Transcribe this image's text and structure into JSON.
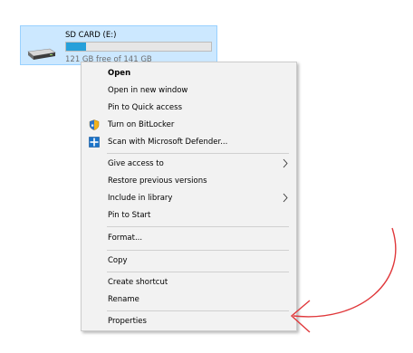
{
  "drive": {
    "name": "SD CARD (E:)",
    "free_text": "121 GB free of 141 GB",
    "used_fraction": 0.14,
    "icon": "sd-card-drive-icon"
  },
  "context_menu": {
    "items": [
      {
        "label": "Open",
        "bold": true
      },
      {
        "label": "Open in new window"
      },
      {
        "label": "Pin to Quick access"
      },
      {
        "label": "Turn on BitLocker",
        "icon": "bitlocker-shield-icon"
      },
      {
        "label": "Scan with Microsoft Defender...",
        "icon": "defender-icon"
      },
      {
        "label": "Give access to",
        "submenu": true
      },
      {
        "label": "Restore previous versions"
      },
      {
        "label": "Include in library",
        "submenu": true
      },
      {
        "label": "Pin to Start"
      },
      {
        "label": "Format..."
      },
      {
        "label": "Copy"
      },
      {
        "label": "Create shortcut"
      },
      {
        "label": "Rename"
      },
      {
        "label": "Properties"
      }
    ]
  },
  "annotation": {
    "color": "#e0383b",
    "points_to": "Properties"
  },
  "colors": {
    "selection_bg": "#cce8ff",
    "selection_border": "#99d1ff",
    "capacity_fill": "#26a0da",
    "menu_bg": "#f2f2f2"
  }
}
